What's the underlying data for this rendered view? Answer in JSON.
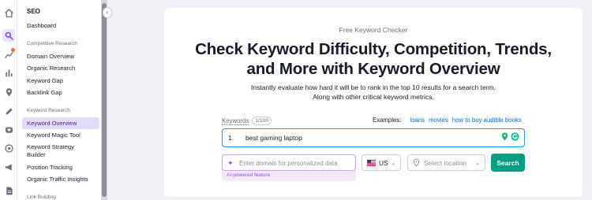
{
  "sidebar": {
    "title": "SEO",
    "dashboard": "Dashboard",
    "sections": [
      {
        "heading": "Competitive Research",
        "items": [
          "Domain Overview",
          "Organic Research",
          "Keyword Gap",
          "Backlink Gap"
        ]
      },
      {
        "heading": "Keyword Research",
        "items": [
          "Keyword Overview",
          "Keyword Magic Tool",
          "Keyword Strategy Builder",
          "Position Tracking",
          "Organic Traffic Insights"
        ]
      },
      {
        "heading": "Link Building"
      }
    ],
    "active_item": "Keyword Overview"
  },
  "rail_icons": [
    "home-icon",
    "seo-icon",
    "trends-icon",
    "bar-chart-icon",
    "location-pin-icon",
    "pen-icon",
    "heart-shield-icon",
    "target-icon",
    "megaphone-icon",
    "document-icon"
  ],
  "main": {
    "eyebrow": "Free Keyword Checker",
    "headline_line1": "Check Keyword Difficulty, Competition, Trends,",
    "headline_line2": "and More with Keyword Overview",
    "subtitle": "Instantly evaluate how hard it will be to rank in the top 10 results for a search term. Along with other critical keyword metrics.",
    "keywords_label": "Keywords",
    "keywords_count": "1/100",
    "examples_label": "Examples:",
    "examples": [
      "loans",
      "movies",
      "how to buy audible books"
    ],
    "keyword_row_number": "1.",
    "keyword_value": "best gaming laptop",
    "domain_placeholder": "Enter domain for personalized data",
    "ai_label": "AI-powered feature",
    "country": "US",
    "location_placeholder": "Select location",
    "search_button": "Search"
  },
  "colors": {
    "accent_purple": "#8f4ee0",
    "search_green": "#009f81",
    "link_blue": "#006dca",
    "input_focus_blue": "#2196f3"
  }
}
